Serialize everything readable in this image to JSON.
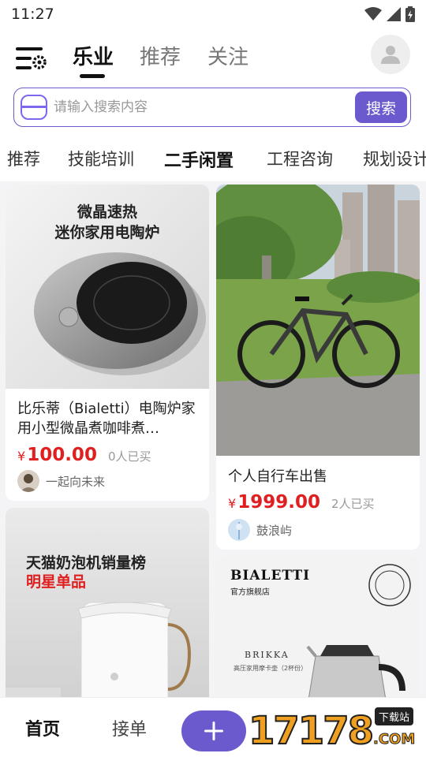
{
  "status": {
    "time": "11:27"
  },
  "header": {
    "tabs": [
      {
        "label": "乐业",
        "active": true
      },
      {
        "label": "推荐",
        "active": false
      },
      {
        "label": "关注",
        "active": false
      }
    ],
    "icons": {
      "menu": "menu-settings-icon",
      "avatar": "user-icon"
    }
  },
  "search": {
    "placeholder": "请输入搜索内容",
    "button_label": "搜索",
    "icon": "search-box-icon"
  },
  "categories": [
    {
      "label": "推荐",
      "active": false
    },
    {
      "label": "技能培训",
      "active": false
    },
    {
      "label": "二手闲置",
      "active": true
    },
    {
      "label": "工程咨询",
      "active": false
    },
    {
      "label": "规划设计",
      "active": false
    }
  ],
  "products": [
    {
      "image_text": [
        "微晶速热",
        "迷你家用电陶炉"
      ],
      "title": "比乐蒂（Bialetti）电陶炉家用小型微晶煮咖啡煮…",
      "currency": "¥",
      "price": "100.00",
      "sold": "0人已买",
      "seller": "一起向未来"
    },
    {
      "title": "个人自行车出售",
      "currency": "¥",
      "price": "1999.00",
      "sold": "2人已买",
      "seller": "鼓浪屿"
    },
    {
      "image_text": [
        "天猫奶泡机销量榜",
        "明星单品"
      ]
    },
    {
      "image_text": [
        "BIALETTI",
        "官方旗舰店",
        "BRIKKA",
        "高压家用摩卡壶（2杯份）"
      ]
    }
  ],
  "bottom_nav": {
    "items": [
      {
        "label": "首页",
        "active": true
      },
      {
        "label": "接单",
        "active": false
      }
    ],
    "publish_icon": "plus-icon"
  },
  "watermark": {
    "text": "17178",
    "suffix": ".COM",
    "badge": "下载站"
  },
  "colors": {
    "accent": "#6a5acd",
    "price": "#e02020"
  }
}
